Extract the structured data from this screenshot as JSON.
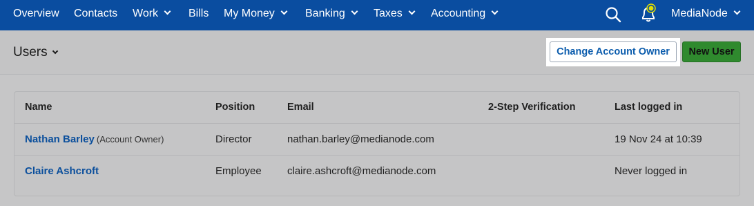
{
  "nav": {
    "items": [
      {
        "label": "Overview",
        "dropdown": false
      },
      {
        "label": "Contacts",
        "dropdown": false
      },
      {
        "label": "Work",
        "dropdown": true
      },
      {
        "label": "Bills",
        "dropdown": false
      },
      {
        "label": "My Money",
        "dropdown": true
      },
      {
        "label": "Banking",
        "dropdown": true
      },
      {
        "label": "Taxes",
        "dropdown": true
      },
      {
        "label": "Accounting",
        "dropdown": true
      }
    ],
    "account_label": "MediaNode",
    "icons": {
      "search": "search-icon",
      "notifications": "bell-icon",
      "account_menu": "chevron-down-icon"
    },
    "colors": {
      "bar": "#0a4da0",
      "notification_dot": "#e3e000"
    }
  },
  "header": {
    "title": "Users",
    "change_owner_label": "Change Account Owner",
    "new_user_label": "New User",
    "colors": {
      "new_user": "#2f8a2e",
      "link": "#0b5cad"
    }
  },
  "table": {
    "columns": [
      "Name",
      "Position",
      "Email",
      "2-Step Verification",
      "Last logged in"
    ],
    "rows": [
      {
        "name": "Nathan Barley",
        "tag": "(Account Owner)",
        "position": "Director",
        "email": "nathan.barley@medianode.com",
        "two_step": "",
        "last_logged_in": "19 Nov 24 at 10:39"
      },
      {
        "name": "Claire Ashcroft",
        "tag": "",
        "position": "Employee",
        "email": "claire.ashcroft@medianode.com",
        "two_step": "",
        "last_logged_in": "Never logged in"
      }
    ]
  }
}
